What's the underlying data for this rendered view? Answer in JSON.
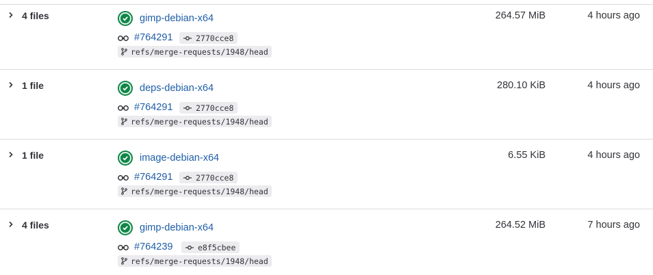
{
  "artifacts": [
    {
      "files": "4 files",
      "job": "gimp-debian-x64",
      "pipeline": "#764291",
      "sha": "2770cce8",
      "ref": "refs/merge-requests/1948/head",
      "size": "264.57 MiB",
      "time": "4 hours ago",
      "status": "success"
    },
    {
      "files": "1 file",
      "job": "deps-debian-x64",
      "pipeline": "#764291",
      "sha": "2770cce8",
      "ref": "refs/merge-requests/1948/head",
      "size": "280.10 KiB",
      "time": "4 hours ago",
      "status": "success"
    },
    {
      "files": "1 file",
      "job": "image-debian-x64",
      "pipeline": "#764291",
      "sha": "2770cce8",
      "ref": "refs/merge-requests/1948/head",
      "size": "6.55 KiB",
      "time": "4 hours ago",
      "status": "success"
    },
    {
      "files": "4 files",
      "job": "gimp-debian-x64",
      "pipeline": "#764239",
      "sha": "e8f5cbee",
      "ref": "refs/merge-requests/1948/head",
      "size": "264.52 MiB",
      "time": "7 hours ago",
      "status": "success"
    }
  ],
  "colors": {
    "success": "#108548",
    "link": "#1f5ea8",
    "badge_bg": "#ececef"
  },
  "icons": {
    "expand": "chevron-right-icon",
    "status": "status-success-icon",
    "pipeline": "pipeline-icon",
    "commit": "commit-icon",
    "branch": "branch-icon"
  }
}
